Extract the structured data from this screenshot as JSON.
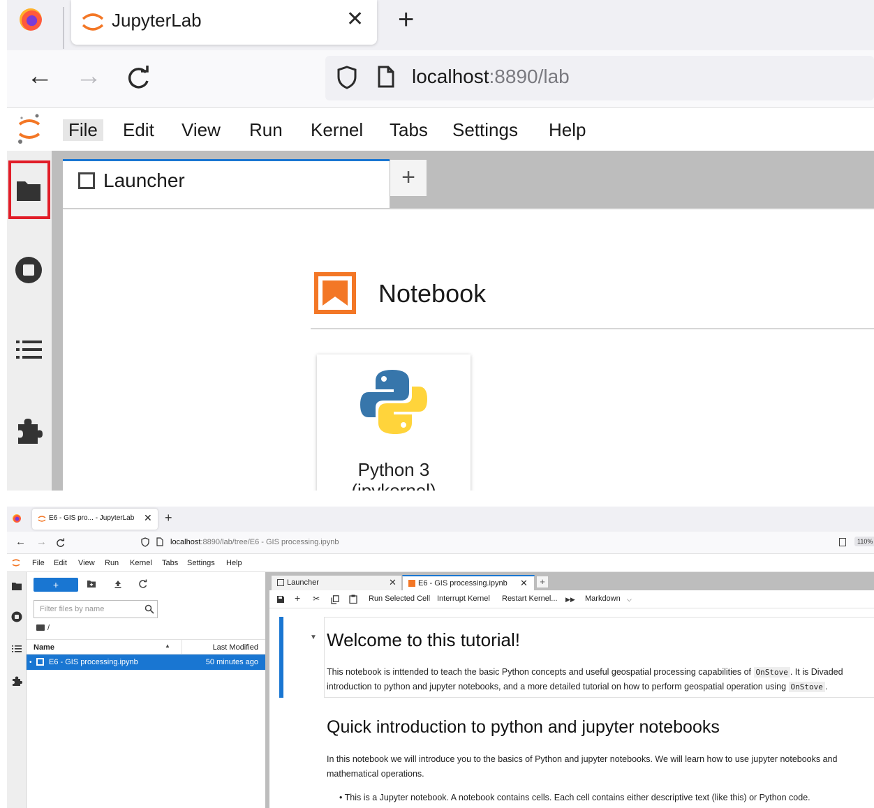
{
  "top": {
    "browser_tab": {
      "title": "JupyterLab",
      "close": "✕"
    },
    "new_tab": "+",
    "nav": {
      "back": "←",
      "forward": "→",
      "reload": "C"
    },
    "url": {
      "host": "localhost",
      "rest": ":8890/lab"
    },
    "menu": [
      "File",
      "Edit",
      "View",
      "Run",
      "Kernel",
      "Tabs",
      "Settings",
      "Help"
    ],
    "dock_tab": {
      "label": "Launcher"
    },
    "dock_add": "+",
    "launcher": {
      "section_title": "Notebook",
      "kernel_card": {
        "line1": "Python 3",
        "line2": "(ipykernel)"
      }
    }
  },
  "bottom": {
    "browser_tab": {
      "title": "E6 - GIS pro... - JupyterLab",
      "close": "✕"
    },
    "new_tab": "+",
    "nav": {
      "back": "←",
      "forward": "→",
      "reload": "C"
    },
    "url": {
      "host": "localhost",
      "rest": ":8890/lab/tree/E6 - GIS processing.ipynb"
    },
    "zoom": "110%",
    "menu": [
      "File",
      "Edit",
      "View",
      "Run",
      "Kernel",
      "Tabs",
      "Settings",
      "Help"
    ],
    "filebrowser": {
      "new_button": "+",
      "filter_placeholder": "Filter files by name",
      "breadcrumb": "/",
      "columns": {
        "name": "Name",
        "modified": "Last Modified"
      },
      "rows": [
        {
          "name": "E6 - GIS processing.ipynb",
          "modified": "50 minutes ago"
        }
      ]
    },
    "dock_tabs": [
      {
        "label": "Launcher",
        "close": "✕"
      },
      {
        "label": "E6 - GIS processing.ipynb",
        "close": "✕"
      }
    ],
    "dock_add": "+",
    "toolbar": {
      "run_selected": "Run Selected Cell",
      "interrupt": "Interrupt Kernel",
      "restart": "Restart Kernel...",
      "cell_type": "Markdown"
    },
    "notebook": {
      "heading1": "Welcome to this tutorial!",
      "p1_line1_a": "This notebook is inttended to teach the basic Python concepts and useful geospatial processing capabilities of ",
      "p1_code1": "OnStove",
      "p1_line1_b": ". It is Divaded",
      "p1_line2_a": "introduction to python and jupyter notebooks, and a more detailed tutorial on how to perform geospatial operation using ",
      "p1_code2": "OnStove",
      "p1_line2_b": ".",
      "heading2": "Quick introduction to python and jupyter notebooks",
      "p2_line1": "In this notebook we will introduce you to the basics of Python and jupyter notebooks. We will learn how to use jupyter notebooks and",
      "p2_line2": "mathematical operations.",
      "bullet1": "• This is a Jupyter notebook. A notebook contains cells. Each cell contains either descriptive text (like this) or Python code."
    }
  }
}
